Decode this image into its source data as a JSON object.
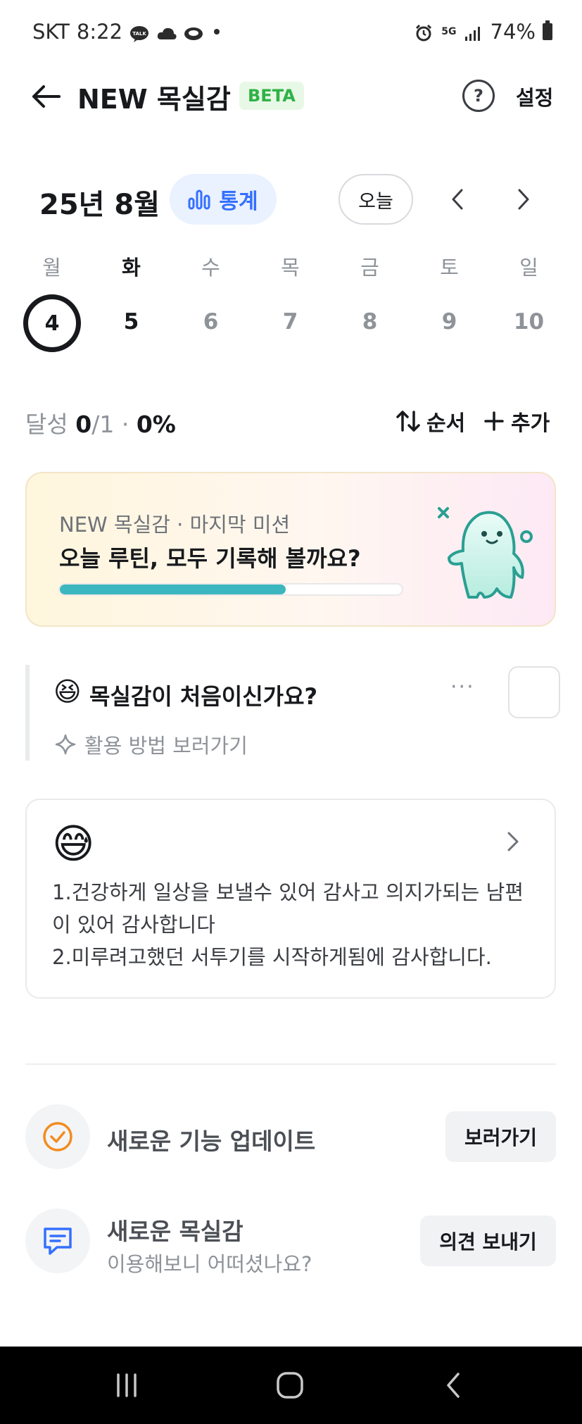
{
  "status_bar": {
    "carrier": "SKT",
    "time": "8:22",
    "network": "5G",
    "battery": "74%"
  },
  "header": {
    "title": "NEW 목실감",
    "badge": "BETA",
    "help_icon": "?",
    "settings_label": "설정"
  },
  "calendar": {
    "month_label": "25년 8월",
    "stats_label": "통계",
    "today_label": "오늘",
    "weekdays": [
      "월",
      "화",
      "수",
      "목",
      "금",
      "토",
      "일"
    ],
    "dates": [
      "4",
      "5",
      "6",
      "7",
      "8",
      "9",
      "10"
    ],
    "selected_index": 0,
    "today_index": 1
  },
  "summary": {
    "achieve_label": "달성",
    "done": "0",
    "total": "/1",
    "separator": "·",
    "percent": "0%",
    "sort_label": "순서",
    "add_label": "추가"
  },
  "mission": {
    "subtitle": "NEW 목실감 · 마지막 미션",
    "headline": "오늘 루틴, 모두 기록해 볼까요?",
    "progress": 0.66
  },
  "routine": {
    "emoji": "😆",
    "name": "목실감이 처음이신가요?",
    "more": "···",
    "guide_label": "활용 방법 보러가기"
  },
  "diary": {
    "emoji": "😅",
    "text": "1.건강하게 일상을 보낼수 있어 감사고 의지가되는 남편이 있어 감사합니다\n2.미루려고했던 서투기를 시작하게됨에 감사합니다."
  },
  "features": [
    {
      "title": "새로운 기능 업데이트",
      "subtitle": "",
      "button": "보러가기",
      "icon": "check-circle-icon"
    },
    {
      "title": "새로운 목실감",
      "subtitle": "이용해보니 어떠셨나요?",
      "button": "의견 보내기",
      "icon": "chat-icon"
    }
  ],
  "colors": {
    "accent_blue": "#3470ff",
    "badge_green": "#2eb245",
    "progress_teal": "#3cb6bf",
    "orange": "#f28c1e"
  }
}
